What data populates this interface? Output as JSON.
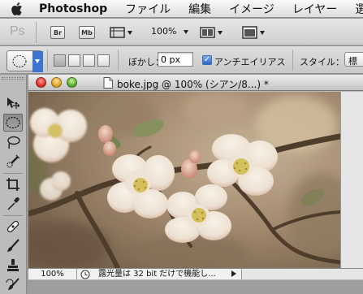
{
  "menubar": {
    "app_name": "Photoshop",
    "items": [
      "ファイル",
      "編集",
      "イメージ",
      "レイヤー",
      "選択範"
    ]
  },
  "appbar": {
    "logo": "Ps",
    "bridge_label": "Br",
    "minibridge_label": "Mb",
    "zoom": "100%"
  },
  "options": {
    "feather_label": "ぼかし：",
    "feather_value": "0 px",
    "antialias_label": "アンチエイリアス",
    "antialias_checked": true,
    "style_label": "スタイル：",
    "style_value": "標"
  },
  "tools": {
    "items": [
      "move-tool-icon",
      "marquee-tool-icon",
      "lasso-tool-icon",
      "quick-selection-tool-icon",
      "crop-tool-icon",
      "eyedropper-tool-icon",
      "healing-brush-tool-icon",
      "brush-tool-icon",
      "clone-stamp-tool-icon",
      "history-brush-tool-icon"
    ],
    "active": "marquee-tool-icon"
  },
  "document": {
    "title": "boke.jpg @ 100% (シアン/8...) *",
    "image_subject": "flowers",
    "zoom_value": "100%",
    "status_text": "露光量は 32 bit だけで機能し..."
  },
  "colors": {
    "accent": "#2c65c8",
    "close": "#d3271b",
    "minimize": "#d99a12",
    "zoom": "#4da424"
  }
}
